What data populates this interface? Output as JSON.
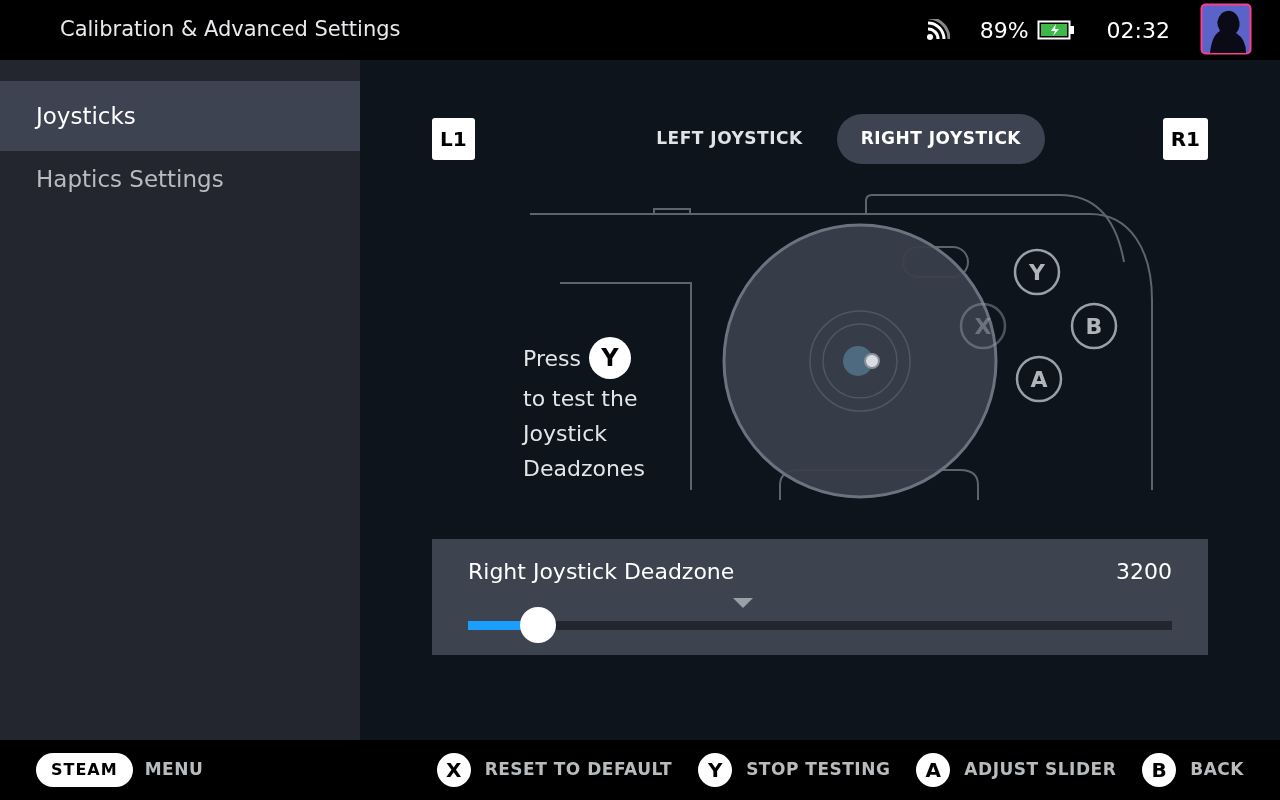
{
  "window": {
    "title": "Calibration & Advanced Settings"
  },
  "status": {
    "battery": "89%",
    "time": "02:32"
  },
  "sidebar": {
    "items": [
      {
        "label": "Joysticks",
        "selected": true
      },
      {
        "label": "Haptics Settings",
        "selected": false
      }
    ]
  },
  "shoulder_buttons": [
    "L1",
    "R1"
  ],
  "tabs": [
    {
      "label": "LEFT JOYSTICK",
      "selected": false
    },
    {
      "label": "RIGHT JOYSTICK",
      "selected": true
    }
  ],
  "prompt": {
    "before": "Press",
    "button": "Y",
    "after": "to test the Joystick Deadzones"
  },
  "face_buttons": [
    {
      "label": "Y",
      "faded": false
    },
    {
      "label": "X",
      "faded": true
    },
    {
      "label": "B",
      "faded": false
    },
    {
      "label": "A",
      "faded": false
    }
  ],
  "slider": {
    "label": "Right Joystick Deadzone",
    "value": "3200",
    "level": 0.1
  },
  "footer": {
    "steam": "STEAM",
    "menu": "MENU",
    "hints": [
      {
        "button": "X",
        "label": "RESET TO DEFAULT"
      },
      {
        "button": "Y",
        "label": "STOP TESTING"
      },
      {
        "button": "A",
        "label": "ADJUST SLIDER"
      },
      {
        "button": "B",
        "label": "BACK"
      }
    ]
  }
}
